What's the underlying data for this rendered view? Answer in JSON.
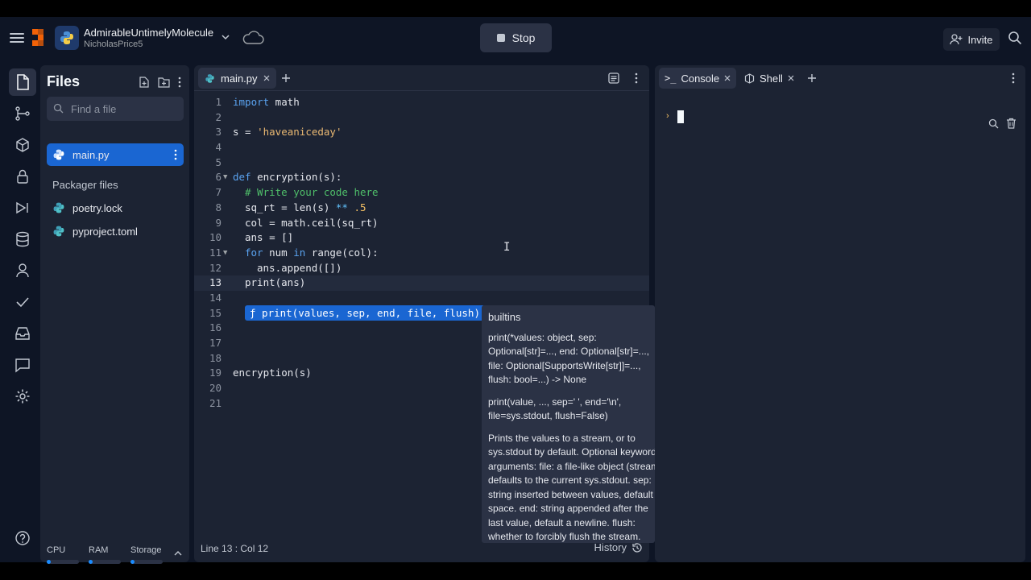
{
  "header": {
    "repl_name": "AdmirableUntimelyMolecule",
    "repl_owner": "NicholasPrice5",
    "run_button_label": "Stop",
    "invite_label": "Invite"
  },
  "files_panel": {
    "title": "Files",
    "search_placeholder": "Find a file",
    "files": [
      {
        "name": "main.py",
        "active": true
      }
    ],
    "packager_heading": "Packager files",
    "packager_files": [
      "poetry.lock",
      "pyproject.toml"
    ],
    "resources": {
      "cpu_label": "CPU",
      "ram_label": "RAM",
      "storage_label": "Storage"
    }
  },
  "editor": {
    "tab_label": "main.py",
    "lines": [
      {
        "n": "1"
      },
      {
        "n": "2"
      },
      {
        "n": "3"
      },
      {
        "n": "4"
      },
      {
        "n": "5"
      },
      {
        "n": "6"
      },
      {
        "n": "7"
      },
      {
        "n": "8"
      },
      {
        "n": "9"
      },
      {
        "n": "10"
      },
      {
        "n": "11"
      },
      {
        "n": "12"
      },
      {
        "n": "13"
      },
      {
        "n": "14"
      },
      {
        "n": "15"
      },
      {
        "n": "16"
      },
      {
        "n": "17"
      },
      {
        "n": "18"
      },
      {
        "n": "19"
      },
      {
        "n": "20"
      },
      {
        "n": "21"
      }
    ],
    "code": {
      "l1_kw": "import",
      "l1_rest": " math",
      "l3_var": "s = ",
      "l3_str": "'haveaniceday'",
      "l6_kw": "def",
      "l6_rest": " encryption(s):",
      "l7_com": "# Write your code here",
      "l8_a": "sq_rt = ",
      "l8_fn": "len",
      "l8_b": "(s) ",
      "l8_op": "**",
      "l8_num": " .5",
      "l9": "col = math.ceil(sq_rt)",
      "l10": "ans = []",
      "l11_kw": "for",
      "l11_a": " num ",
      "l11_kw2": "in",
      "l11_b": " range(col):",
      "l12": "ans.append([])",
      "l13": "print(ans)",
      "l19": "encryption(s)"
    },
    "signature_hint": "ƒ print(values, sep, end, file, flush)",
    "status_position": "Line 13 : Col 12",
    "history_label": "History"
  },
  "tooltip": {
    "heading": "builtins",
    "signature_1": "print(*values: object, sep: Optional[str]=..., end: Optional[str]=..., file: Optional[SupportsWrite[str]]=..., flush: bool=...) -> None",
    "signature_2": "print(value, ..., sep=' ', end='\\n', file=sys.stdout, flush=False)",
    "description": "Prints the values to a stream, or to sys.stdout by default. Optional keyword arguments: file:  a file-like object (stream); defaults to the current sys.stdout. sep:   string inserted between values, default a space. end:   string appended after the last value, default a newline. flush: whether to forcibly flush the stream."
  },
  "console": {
    "tabs": [
      "Console",
      "Shell"
    ],
    "prompt": "›"
  },
  "colors": {
    "accent": "#1a66d2",
    "background": "#0e1525",
    "panel": "#1c2333",
    "brand": "#f26207"
  }
}
